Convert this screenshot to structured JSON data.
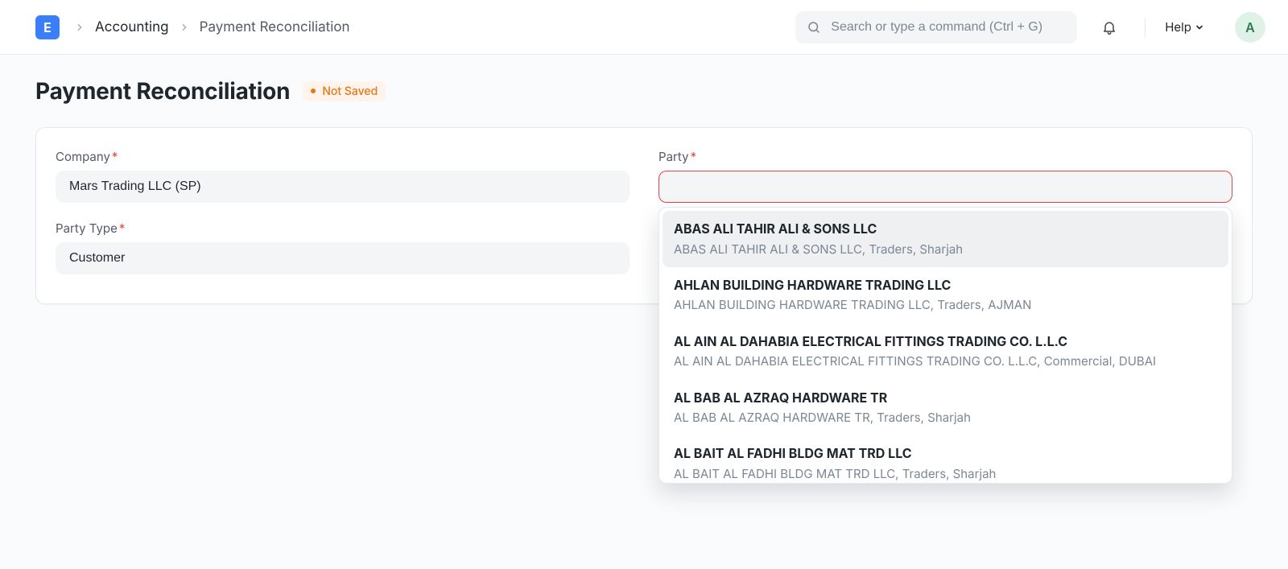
{
  "header": {
    "logo_letter": "E",
    "breadcrumbs": [
      "Accounting",
      "Payment Reconciliation"
    ],
    "search_placeholder": "Search or type a command (Ctrl + G)",
    "help_label": "Help",
    "avatar_initial": "A"
  },
  "page": {
    "title": "Payment Reconciliation",
    "status": "Not Saved"
  },
  "form": {
    "company": {
      "label": "Company",
      "required": true,
      "value": "Mars Trading LLC (SP)"
    },
    "party_type": {
      "label": "Party Type",
      "required": true,
      "value": "Customer"
    },
    "party": {
      "label": "Party",
      "required": true,
      "value": "",
      "options": [
        {
          "title": "ABAS ALI TAHIR ALI & SONS LLC",
          "sub": "ABAS ALI TAHIR ALI & SONS LLC, Traders, Sharjah"
        },
        {
          "title": "AHLAN BUILDING HARDWARE TRADING LLC",
          "sub": "AHLAN BUILDING HARDWARE TRADING LLC, Traders, AJMAN"
        },
        {
          "title": "AL AIN AL DAHABIA ELECTRICAL FITTINGS TRADING CO. L.L.C",
          "sub": "AL AIN AL DAHABIA ELECTRICAL FITTINGS TRADING CO. L.L.C, Commercial, DUBAI"
        },
        {
          "title": "AL BAB AL AZRAQ HARDWARE TR",
          "sub": "AL BAB AL AZRAQ HARDWARE TR, Traders, Sharjah"
        },
        {
          "title": "AL BAIT AL FADHI BLDG MAT TRD LLC",
          "sub": "AL BAIT AL FADHI BLDG MAT TRD LLC, Traders, Sharjah"
        }
      ]
    }
  }
}
